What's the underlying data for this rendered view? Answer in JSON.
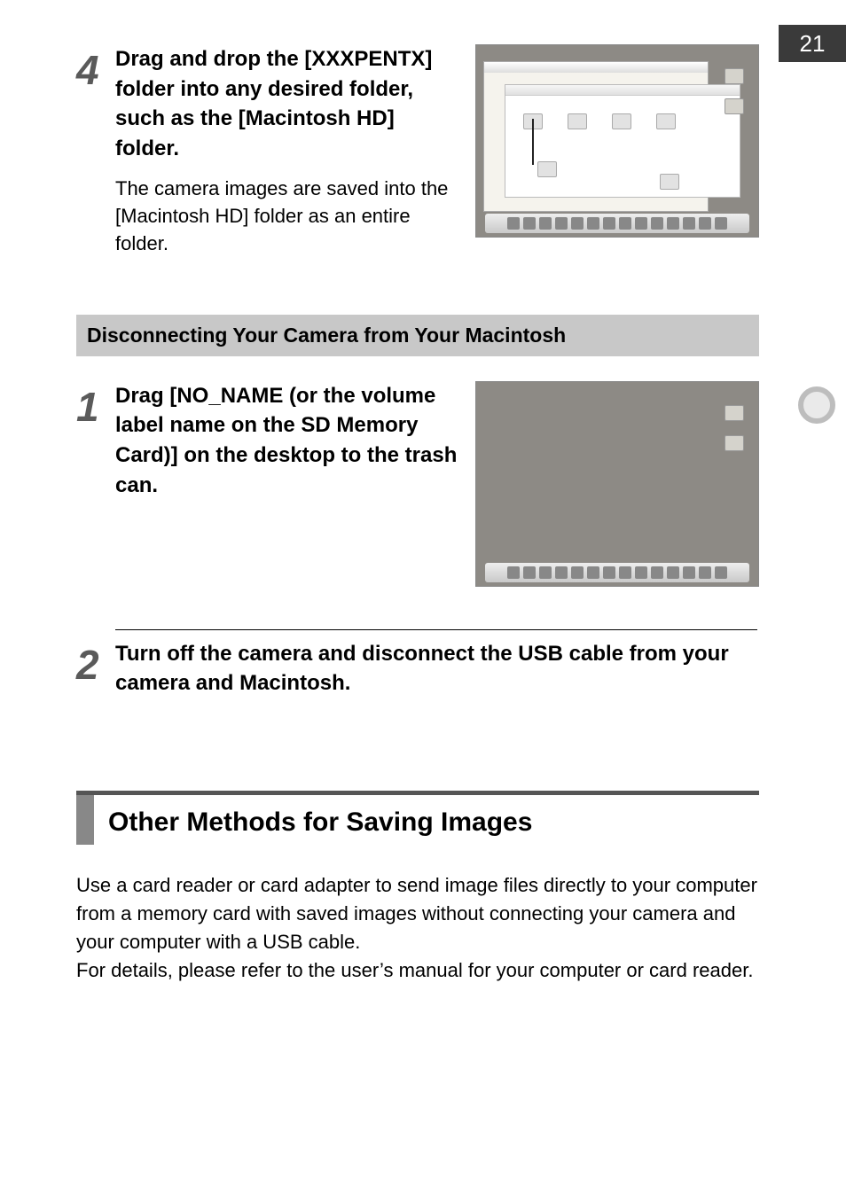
{
  "page_number": "21",
  "step4": {
    "num": "4",
    "title": "Drag and drop the [XXXPENTX] folder into any desired folder, such as the [Macintosh HD] folder.",
    "desc": "The camera images are saved into the [Macintosh HD] folder as an entire folder."
  },
  "gray_heading": "Disconnecting Your Camera from Your Macintosh",
  "step1": {
    "num": "1",
    "title": "Drag [NO_NAME (or the volume label name on the SD Memory Card)] on the desktop to the trash can."
  },
  "step2": {
    "num": "2",
    "title": "Turn off the camera and disconnect the USB cable from your camera and Macintosh."
  },
  "section": {
    "title": "Other Methods for Saving Images",
    "body": "Use a card reader or card adapter to send image files directly to your computer from a memory card with saved images without connecting your camera and your computer with a USB cable.\nFor details, please refer to the user’s manual for your computer or card reader."
  }
}
